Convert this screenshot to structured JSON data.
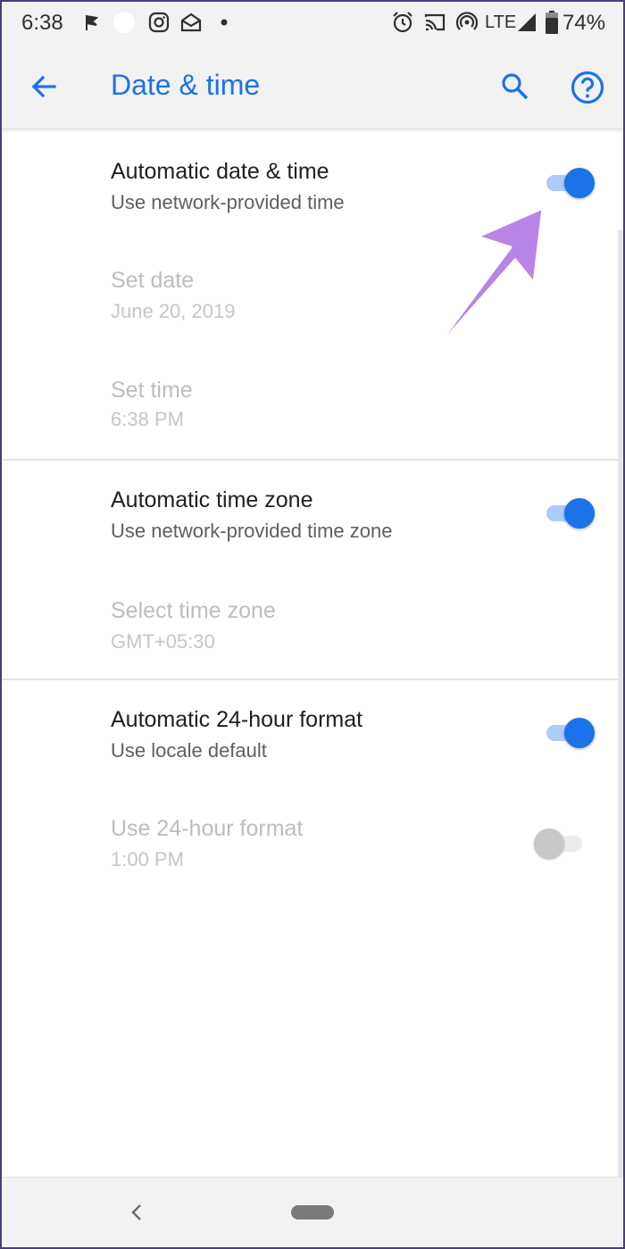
{
  "status_bar": {
    "time": "6:38",
    "network": "LTE",
    "battery": "74%",
    "icons": [
      "flag-icon",
      "circle-notification-icon",
      "instagram-icon",
      "mail-icon",
      "dot-icon",
      "alarm-icon",
      "cast-icon",
      "hotspot-icon",
      "signal-icon",
      "battery-icon"
    ]
  },
  "app_bar": {
    "title": "Date & time",
    "back_icon": "arrow-back-icon",
    "search_icon": "search-icon",
    "help_icon": "help-icon"
  },
  "settings": [
    {
      "title": "Automatic date & time",
      "summary": "Use network-provided time",
      "enabled": true,
      "toggle": "on"
    },
    {
      "title": "Set date",
      "summary": "June 20, 2019",
      "enabled": false
    },
    {
      "title": "Set time",
      "summary": "6:38 PM",
      "enabled": false
    },
    {
      "title": "Automatic time zone",
      "summary": "Use network-provided time zone",
      "enabled": true,
      "toggle": "on"
    },
    {
      "title": "Select time zone",
      "summary": "GMT+05:30",
      "enabled": false
    },
    {
      "title": "Automatic 24-hour format",
      "summary": "Use locale default",
      "enabled": true,
      "toggle": "on"
    },
    {
      "title": "Use 24-hour format",
      "summary": "1:00 PM",
      "enabled": false,
      "toggle": "off"
    }
  ],
  "colors": {
    "accent": "#1a73e8",
    "annotation_arrow": "#b884e6",
    "toggle_track_on": "#aecbfa"
  },
  "nav_bar": {
    "back_icon": "nav-back-icon",
    "home_icon": "home-pill-icon"
  }
}
